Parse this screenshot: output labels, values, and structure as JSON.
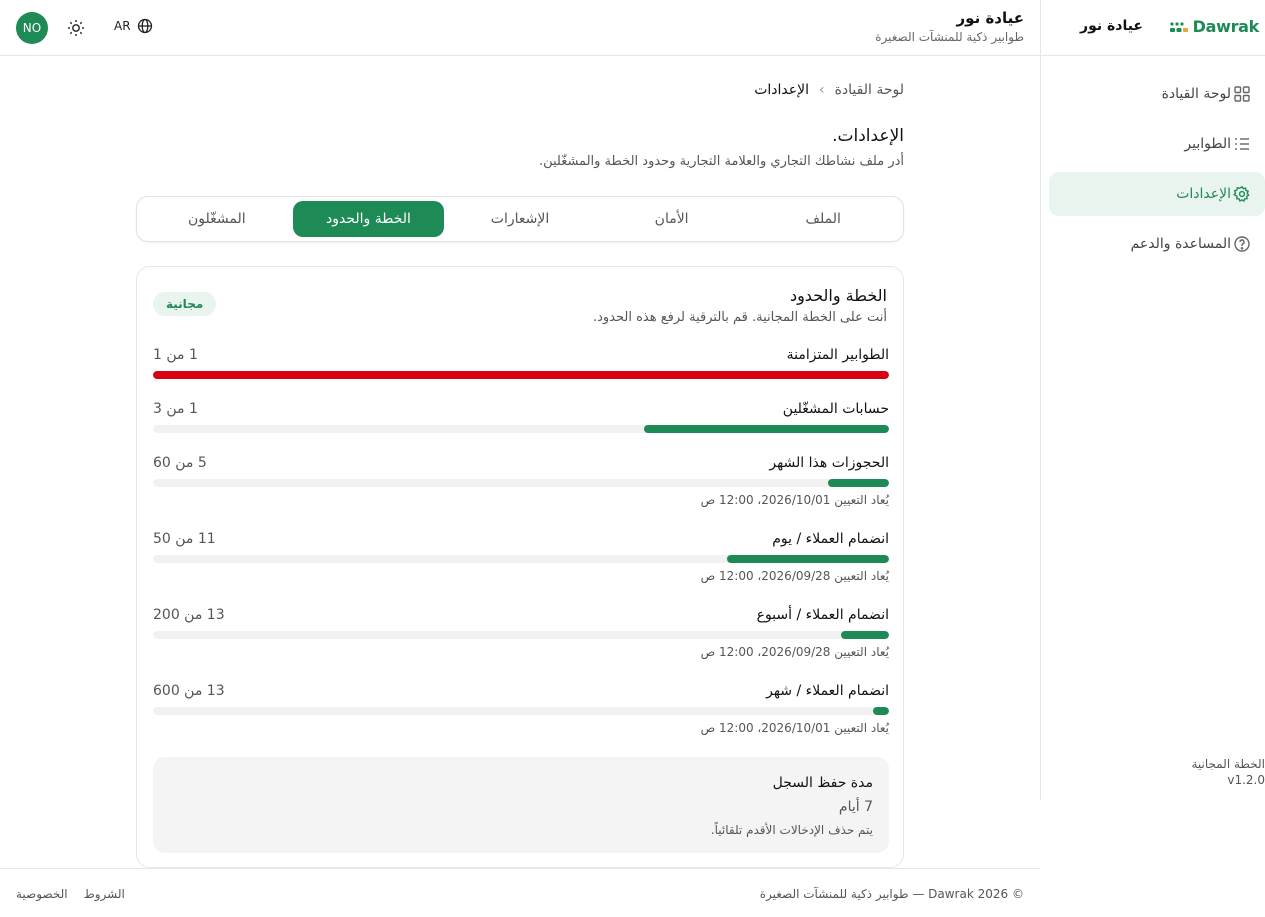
{
  "brand": {
    "logo_text": "Dawrak",
    "name": "عيادة نور"
  },
  "topbar": {
    "org_title": "عيادة نور",
    "org_subtitle": "طوابير ذكية للمنشآت الصغيرة",
    "avatar_initials": "NO",
    "lang_label": "AR"
  },
  "sidebar": {
    "items": [
      {
        "label": "لوحة القيادة",
        "icon": "dashboard-icon",
        "active": false
      },
      {
        "label": "الطوابير",
        "icon": "list-icon",
        "active": false
      },
      {
        "label": "الإعدادات",
        "icon": "gear-icon",
        "active": true
      },
      {
        "label": "المساعدة والدعم",
        "icon": "help-icon",
        "active": false
      }
    ],
    "plan_label": "الخطة المجانية",
    "version": "v1.2.0"
  },
  "breadcrumb": {
    "parent": "لوحة القيادة",
    "separator": "›",
    "current": "الإعدادات"
  },
  "page": {
    "title": "الإعدادات.",
    "subtitle": "أدر ملف نشاطك التجاري والعلامة التجارية وحدود الخطة والمشغّلين."
  },
  "tabs": [
    {
      "label": "الملف",
      "active": false
    },
    {
      "label": "الأمان",
      "active": false
    },
    {
      "label": "الإشعارات",
      "active": false
    },
    {
      "label": "الخطة والحدود",
      "active": true
    },
    {
      "label": "المشغّلون",
      "active": false
    }
  ],
  "plan": {
    "title": "الخطة والحدود",
    "subtitle": "أنت على الخطة المجانية. قم بالترقية لرفع هذه الحدود.",
    "badge": "مجانية",
    "limits": [
      {
        "name": "الطوابير المتزامنة",
        "count": "1 من 1",
        "used": 1,
        "max": 1,
        "reset": ""
      },
      {
        "name": "حسابات المشغّلين",
        "count": "1 من 3",
        "used": 1,
        "max": 3,
        "reset": ""
      },
      {
        "name": "الحجوزات هذا الشهر",
        "count": "5 من 60",
        "used": 5,
        "max": 60,
        "reset": "يُعاد التعيين 2026/10/01، 12:00 ص"
      },
      {
        "name": "انضمام العملاء / يوم",
        "count": "11 من 50",
        "used": 11,
        "max": 50,
        "reset": "يُعاد التعيين 2026/09/28، 12:00 ص"
      },
      {
        "name": "انضمام العملاء / أسبوع",
        "count": "13 من 200",
        "used": 13,
        "max": 200,
        "reset": "يُعاد التعيين 2026/09/28، 12:00 ص"
      },
      {
        "name": "انضمام العملاء / شهر",
        "count": "13 من 600",
        "used": 13,
        "max": 600,
        "reset": "يُعاد التعيين 2026/10/01، 12:00 ص"
      }
    ],
    "retention": {
      "title": "مدة حفظ السجل",
      "value": "7 أيام",
      "note": "يتم حذف الإدخالات الأقدم تلقائياً."
    }
  },
  "footer": {
    "copyright": "© 2026 Dawrak — طوابير ذكية للمنشآت الصغيرة",
    "links": [
      "الشروط",
      "الخصوصية"
    ]
  },
  "colors": {
    "accent": "#1e8a55",
    "danger": "#d90012",
    "accent_soft": "#e9f4ee"
  }
}
